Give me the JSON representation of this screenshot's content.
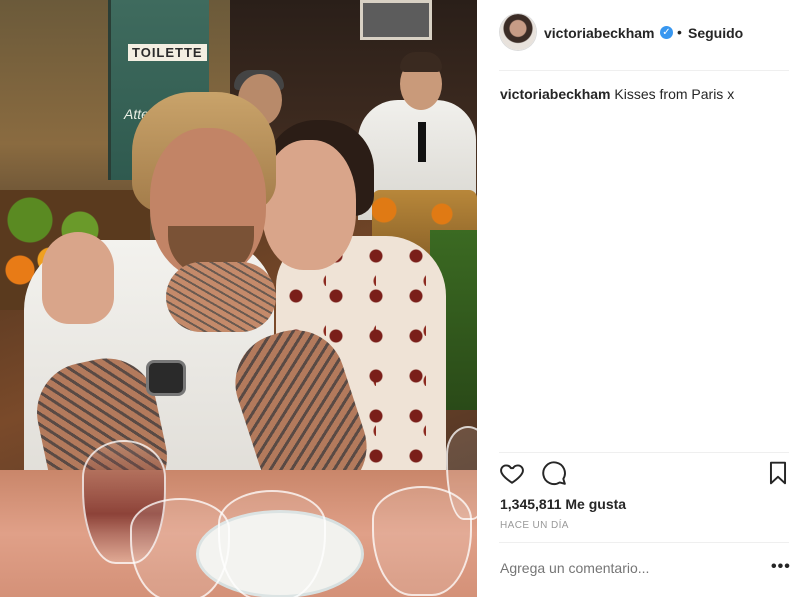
{
  "photo": {
    "sign_text": "TOILETTE",
    "sign_subtext": "Atten"
  },
  "header": {
    "username": "victoriabeckham",
    "verified_icon": "verified-badge-icon",
    "separator": "•",
    "follow_status": "Seguido"
  },
  "caption": {
    "username": "victoriabeckham",
    "text": "Kisses from Paris x"
  },
  "actions": {
    "like_icon": "heart-icon",
    "comment_icon": "comment-icon",
    "save_icon": "bookmark-icon"
  },
  "likes_text": "1,345,811 Me gusta",
  "timestamp": "HACE UN DÍA",
  "comment_input": {
    "placeholder": "Agrega un comentario..."
  },
  "more_options_label": "•••",
  "colors": {
    "verified": "#3897f0",
    "text": "#262626",
    "muted": "#999999",
    "divider": "#efefef"
  }
}
